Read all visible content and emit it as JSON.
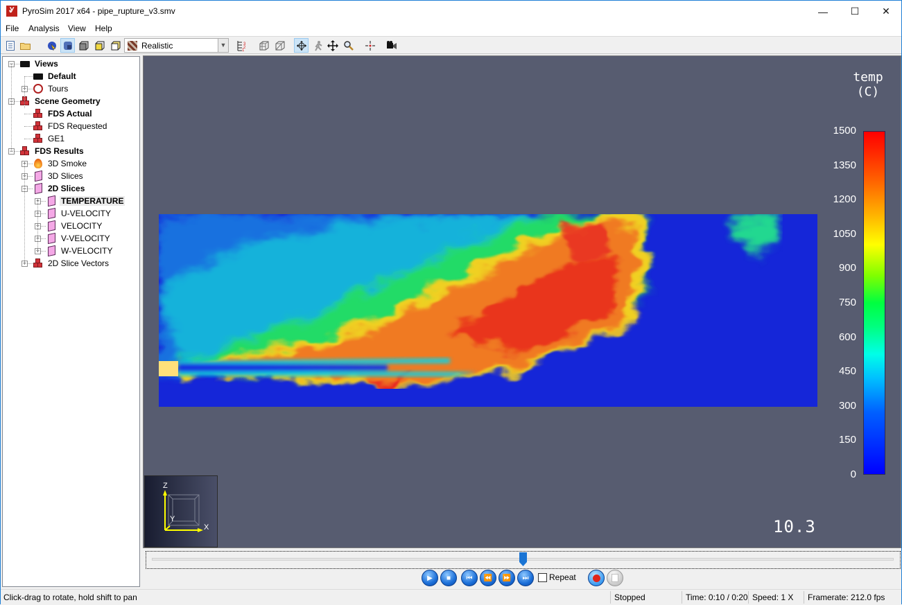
{
  "window": {
    "title": "PyroSim 2017 x64 - pipe_rupture_v3.smv",
    "minimize": "—",
    "maximize": "☐",
    "close": "✕"
  },
  "menu": [
    "File",
    "Analysis",
    "View",
    "Help"
  ],
  "toolbar": {
    "render_mode": "Realistic",
    "icons": [
      "new-file-icon",
      "open-folder-icon",
      "select-icon",
      "view-smooth-icon",
      "view-outline-icon",
      "view-shaded-icon",
      "view-solid-icon",
      "render-mode-select",
      "legend-icon",
      "wireframe-grid-icon",
      "wireframe-box-icon",
      "orbit-icon",
      "walk-icon",
      "pan-icon",
      "zoom-icon",
      "center-icon",
      "camera-icon"
    ]
  },
  "tree": [
    {
      "label": "Views",
      "bold": true,
      "level": 0,
      "expander": "-",
      "icon": "cameras-icon"
    },
    {
      "label": "Default",
      "bold": true,
      "level": 1,
      "expander": "",
      "icon": "camera-icon"
    },
    {
      "label": "Tours",
      "bold": false,
      "level": 1,
      "expander": "+",
      "icon": "tour-icon"
    },
    {
      "label": "Scene Geometry",
      "bold": true,
      "level": 0,
      "expander": "-",
      "icon": "geometry-icon"
    },
    {
      "label": "FDS Actual",
      "bold": true,
      "level": 1,
      "expander": "",
      "icon": "geometry-icon"
    },
    {
      "label": "FDS Requested",
      "bold": false,
      "level": 1,
      "expander": "",
      "icon": "geometry-icon"
    },
    {
      "label": "GE1",
      "bold": false,
      "level": 1,
      "expander": "",
      "icon": "geometry-icon"
    },
    {
      "label": "FDS Results",
      "bold": true,
      "level": 0,
      "expander": "-",
      "icon": "geometry-icon"
    },
    {
      "label": "3D Smoke",
      "bold": false,
      "level": 1,
      "expander": "+",
      "icon": "smoke-icon"
    },
    {
      "label": "3D Slices",
      "bold": false,
      "level": 1,
      "expander": "+",
      "icon": "slice-icon"
    },
    {
      "label": "2D Slices",
      "bold": true,
      "level": 1,
      "expander": "-",
      "icon": "slice-icon"
    },
    {
      "label": "TEMPERATURE",
      "bold": true,
      "level": 2,
      "expander": "+",
      "icon": "slice-icon",
      "selected": true
    },
    {
      "label": "U-VELOCITY",
      "bold": false,
      "level": 2,
      "expander": "+",
      "icon": "slice-icon"
    },
    {
      "label": "VELOCITY",
      "bold": false,
      "level": 2,
      "expander": "+",
      "icon": "slice-icon"
    },
    {
      "label": "V-VELOCITY",
      "bold": false,
      "level": 2,
      "expander": "+",
      "icon": "slice-icon"
    },
    {
      "label": "W-VELOCITY",
      "bold": false,
      "level": 2,
      "expander": "+",
      "icon": "slice-icon"
    },
    {
      "label": "2D Slice Vectors",
      "bold": false,
      "level": 1,
      "expander": "+",
      "icon": "geometry-icon"
    }
  ],
  "viewport": {
    "colorbar_title_line1": "temp",
    "colorbar_title_line2": "(C)",
    "colorbar_ticks": [
      "1500",
      "1350",
      "1200",
      "1050",
      "900",
      "750",
      "600",
      "450",
      "300",
      "150",
      "0"
    ],
    "colorbar_range": [
      0,
      1500
    ],
    "time_display": "10.3",
    "axes": {
      "z": "Z",
      "y": "Y",
      "x": "X"
    }
  },
  "playback": {
    "progress": 0.5,
    "repeat_label": "Repeat",
    "repeat_checked": false,
    "buttons": [
      "play",
      "stop",
      "skip-to-start",
      "rewind",
      "fast-forward",
      "skip-to-end"
    ]
  },
  "status": {
    "hint": "Click-drag to rotate, hold shift to pan",
    "state": "Stopped",
    "time": "Time: 0:10 / 0:20",
    "speed": "Speed: 1 X",
    "framerate": "Framerate: 212.0 fps"
  }
}
